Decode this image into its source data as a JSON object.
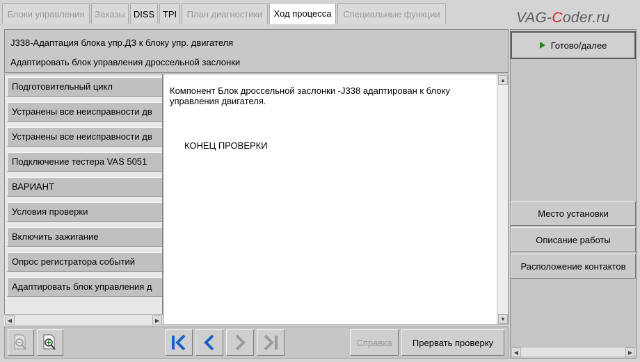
{
  "tabs": [
    {
      "label": "Блоки управления",
      "state": "disabled"
    },
    {
      "label": "Заказы",
      "state": "disabled"
    },
    {
      "label": "DISS",
      "state": "enabled"
    },
    {
      "label": "TPI",
      "state": "enabled"
    },
    {
      "label": "План диагностики",
      "state": "disabled"
    },
    {
      "label": "Ход процесса",
      "state": "active"
    },
    {
      "label": "Специальные функции",
      "state": "disabled"
    }
  ],
  "watermark": {
    "prefix": "VAG-",
    "accent": "C",
    "suffix": "oder.ru"
  },
  "header": {
    "title": "J338-Адаптация блока упр.ДЗ к блоку упр. двигателя",
    "subtitle": "Адаптировать блок управления дроссельной заслонки"
  },
  "steps": [
    "Подготовительный цикл",
    "Устранены все неисправности дв",
    "Устранены все неисправности дв",
    "Подключение тестера VAS 5051",
    "ВАРИАНТ",
    "Условия проверки",
    "Включить зажигание",
    "Опрос регистратора событий",
    "Адаптировать блок управления д"
  ],
  "content": {
    "message": "Компонент Блок дроссельной заслонки -J338 адаптирован к блоку управления двигателя.",
    "end_text": "КОНЕЦ ПРОВЕРКИ"
  },
  "toolbar": {
    "help_label": "Справка",
    "abort_label": "Прервать проверку"
  },
  "right_panel": {
    "done_label": "Готово/далее",
    "install_location_label": "Место установки",
    "work_description_label": "Описание работы",
    "contacts_label": "Расположение контактов"
  },
  "colors": {
    "nav_blue": "#1a5fc8",
    "nav_disabled": "#9a9a9a",
    "play_green": "#1e8a1e",
    "watermark_red": "#d32222"
  }
}
